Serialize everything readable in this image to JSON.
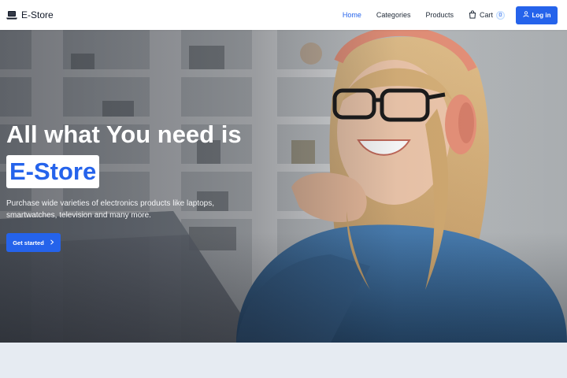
{
  "brand": {
    "name": "E-Store",
    "icon": "laptop-icon"
  },
  "nav": {
    "links": [
      {
        "label": "Home",
        "active": true
      },
      {
        "label": "Categories",
        "active": false
      },
      {
        "label": "Products",
        "active": false
      }
    ],
    "cart": {
      "label": "Cart",
      "count": "0",
      "icon": "shopping-bag-icon"
    },
    "login": {
      "label": "Log in",
      "icon": "user-icon"
    }
  },
  "hero": {
    "headline": "All what You need is",
    "highlight": "E-Store",
    "description": "Purchase wide varieties of electronics products like laptops, smartwatches, television and many more.",
    "cta": {
      "label": "Get started",
      "icon": "chevron-right-icon"
    }
  },
  "colors": {
    "primary": "#2563eb",
    "nav_bg": "#ffffff",
    "text_dark": "#1f2937",
    "page_bg": "#e6ebf2",
    "headphones": "#e8927a",
    "sweater": "#3e6f9f",
    "hair": "#d9b481"
  }
}
